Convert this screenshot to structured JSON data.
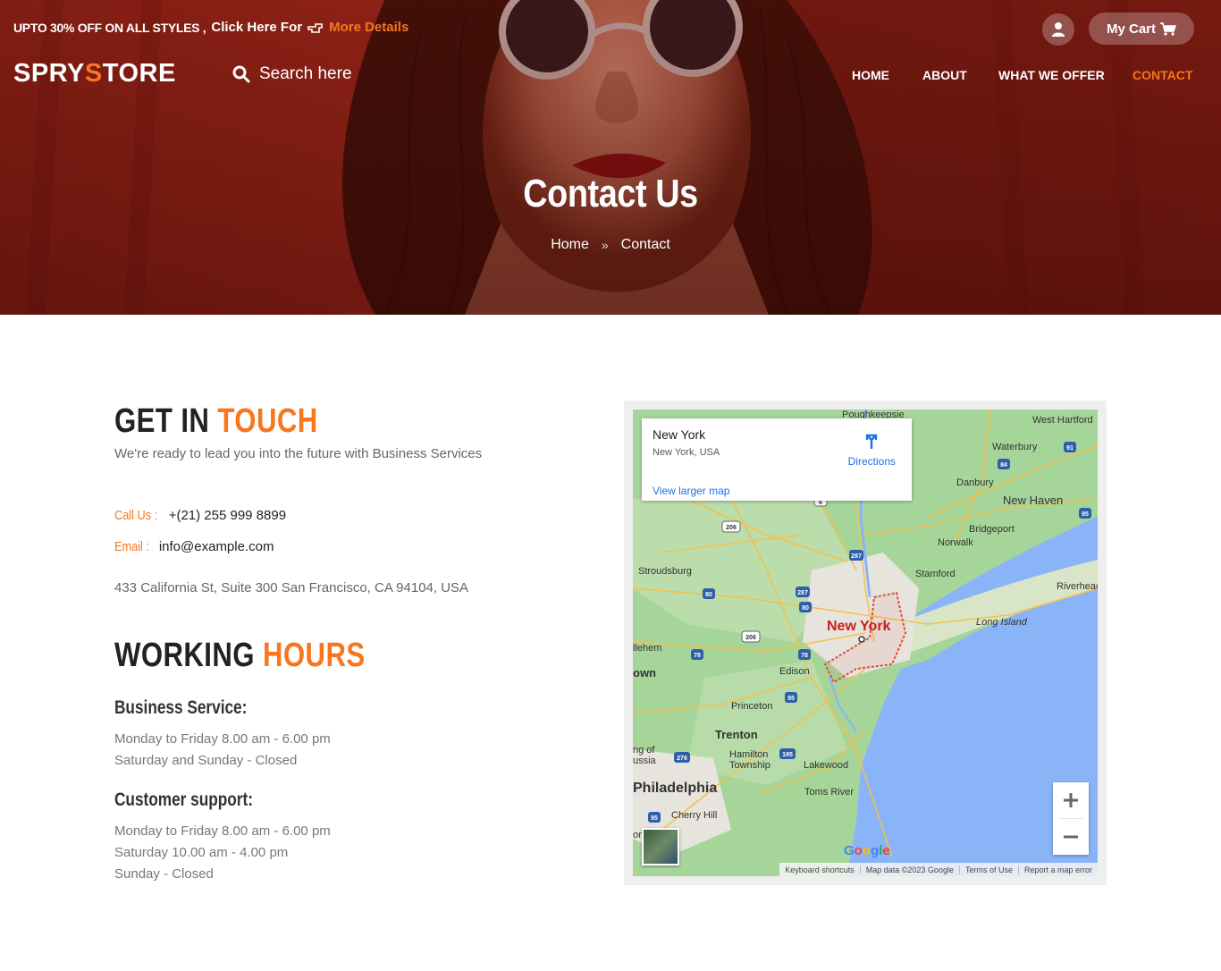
{
  "promo": {
    "text": "UPTO 30% OFF ON ALL STYLES ,",
    "click": "Click Here For",
    "link": "More Details"
  },
  "header": {
    "cart_label": "My Cart",
    "logo_part1": "SPRY",
    "logo_accent": "S",
    "logo_part2": "TORE",
    "search_placeholder": "Search here"
  },
  "nav": {
    "items": [
      {
        "label": "HOME"
      },
      {
        "label": "ABOUT"
      },
      {
        "label": "WHAT WE OFFER"
      },
      {
        "label": "CONTACT"
      }
    ],
    "active": "CONTACT"
  },
  "hero": {
    "title": "Contact Us",
    "crumb_home": "Home",
    "crumb_current": "Contact"
  },
  "touch": {
    "heading_dark": "GET IN",
    "heading_accent": "TOUCH",
    "lead": "We're ready to lead you into the future with Business Services",
    "call_label": "Call Us :",
    "call_value": "+(21) 255 999 8899",
    "email_label": "Email :",
    "email_value": "info@example.com",
    "address": "433 California St, Suite 300 San Francisco, CA 94104, USA"
  },
  "hours": {
    "heading_dark": "WORKING",
    "heading_accent": "HOURS",
    "business_title": "Business Service:",
    "business_lines": [
      "Monday to Friday 8.00 am - 6.00 pm",
      "Saturday and Sunday - Closed"
    ],
    "support_title": "Customer support:",
    "support_lines": [
      "Monday to Friday 8.00 am - 6.00 pm",
      "Saturday 10.00 am - 4.00 pm",
      "Sunday - Closed"
    ]
  },
  "map": {
    "place_title": "New York",
    "place_subtitle": "New York, USA",
    "directions": "Directions",
    "view_larger": "View larger map",
    "city_label": "New York",
    "labels": [
      "Poughkeepsie",
      "West Hartford",
      "Waterbury",
      "Danbury",
      "New Haven",
      "Bridgeport",
      "Norwalk",
      "Stamford",
      "Riverhead",
      "Long Island",
      "Stroudsburg",
      "Edison",
      "Princeton",
      "Trenton",
      "Hamilton Township",
      "Lakewood",
      "Toms River",
      "Philadelphia",
      "Cherry Hill",
      "llehem",
      "own",
      "ng of",
      "ussia",
      "or"
    ],
    "shields": [
      "84",
      "91",
      "95",
      "206",
      "287",
      "80",
      "78",
      "287",
      "80",
      "206",
      "78",
      "95",
      "276",
      "195",
      "95",
      "6"
    ],
    "google": "Google",
    "attrib": [
      "Keyboard shortcuts",
      "Map data ©2023 Google",
      "Terms of Use",
      "Report a map error"
    ],
    "colors": {
      "land": "#a6d59a",
      "water": "#8ab4f8",
      "urban": "#e6e4dd",
      "roads": "#f4c04a",
      "boundary": "#e04a3c"
    }
  },
  "colors": {
    "accent": "#f7761f",
    "hero": "#7a1d14",
    "link": "#1a73e8"
  }
}
